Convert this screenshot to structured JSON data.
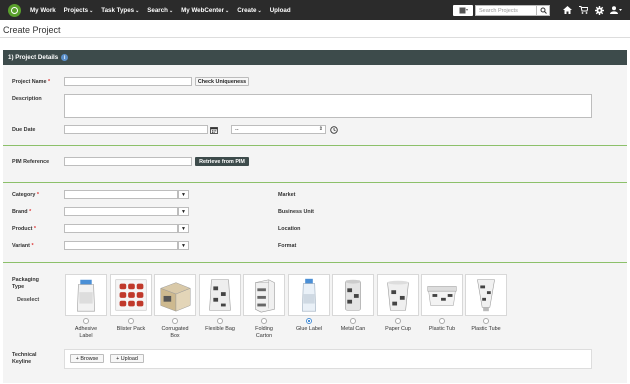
{
  "nav": {
    "items": [
      {
        "label": "My Work",
        "caret": false
      },
      {
        "label": "Projects",
        "caret": true
      },
      {
        "label": "Task Types",
        "caret": true
      },
      {
        "label": "Search",
        "caret": true
      },
      {
        "label": "My WebCenter",
        "caret": true
      },
      {
        "label": "Create",
        "caret": true
      },
      {
        "label": "Upload",
        "caret": false
      }
    ],
    "search_placeholder": "Search Projects",
    "icons": [
      "home-icon",
      "cart-icon",
      "gear-icon",
      "user-icon"
    ]
  },
  "page": {
    "title": "Create Project"
  },
  "section": {
    "title": "1) Project Details"
  },
  "form": {
    "project_name": {
      "label": "Project Name",
      "value": "",
      "check_button": "Check Uniqueness"
    },
    "description": {
      "label": "Description",
      "value": ""
    },
    "due_date": {
      "label": "Due Date",
      "date_value": "",
      "time_value": "--"
    },
    "pim": {
      "label": "PIM Reference",
      "value": "",
      "button": "Retrieve from PIM"
    },
    "category": {
      "label": "Category"
    },
    "brand": {
      "label": "Brand"
    },
    "product": {
      "label": "Product"
    },
    "variant": {
      "label": "Variant"
    },
    "market": {
      "label": "Market"
    },
    "business_unit": {
      "label": "Business Unit"
    },
    "location": {
      "label": "Location"
    },
    "format": {
      "label": "Format"
    },
    "packaging": {
      "label": "Packaging Type",
      "deselect": "Deselect",
      "options": [
        {
          "label": "Adhesive Label",
          "selected": false
        },
        {
          "label": "Blister Pack",
          "selected": false
        },
        {
          "label": "Corrugated Box",
          "selected": false
        },
        {
          "label": "Flexible Bag",
          "selected": false
        },
        {
          "label": "Folding Carton",
          "selected": false
        },
        {
          "label": "Glue Label",
          "selected": true
        },
        {
          "label": "Metal Can",
          "selected": false
        },
        {
          "label": "Paper Cup",
          "selected": false
        },
        {
          "label": "Plastic Tub",
          "selected": false
        },
        {
          "label": "Plastic Tube",
          "selected": false
        }
      ]
    },
    "keyline": {
      "label": "Technical Keyline",
      "browse": "+ Browse",
      "upload": "+ Upload"
    }
  },
  "colors": {
    "nav_bg": "#2b2b2b",
    "header_bg": "#3d4b4b",
    "accent_green": "#5aa02c",
    "rule_green": "#8cc06a",
    "required": "#dd3333"
  }
}
